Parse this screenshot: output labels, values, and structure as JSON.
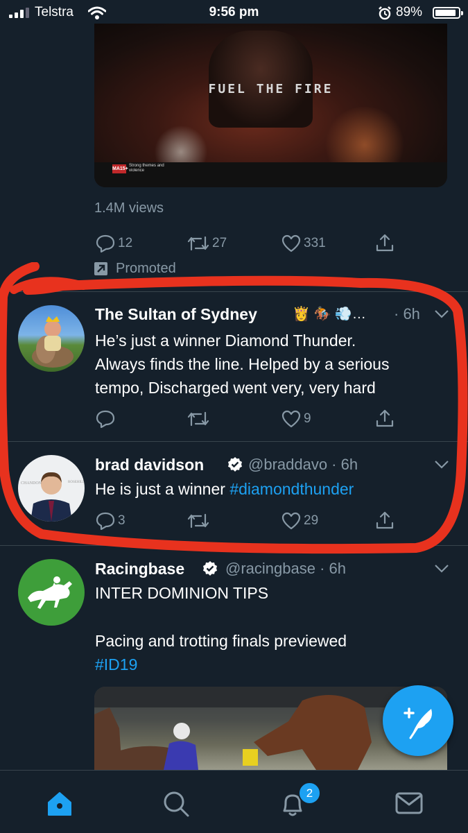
{
  "status_bar": {
    "carrier": "Telstra",
    "time": "9:56 pm",
    "battery": "89%"
  },
  "promo": {
    "video_title": "FUEL THE FIRE",
    "rating_label": "MA15+",
    "rating_text": "Strong themes and violence",
    "views": "1.4M views",
    "replies": "12",
    "retweets": "27",
    "likes": "331",
    "promoted_label": "Promoted"
  },
  "tweets": [
    {
      "name": "The Sultan of Sydney",
      "name_emoji": "👸 🏇 💨…",
      "time": "· 6h",
      "lines": [
        "He’s just a winner Diamond Thunder.",
        "Always finds the line. Helped by a serious",
        "tempo, Discharged went very, very hard"
      ],
      "replies": "",
      "retweets": "",
      "likes": "9"
    },
    {
      "name": "brad davidson",
      "handle": "@braddavo · 6h",
      "text": "He is just a winner ",
      "hashtag": "#diamondthunder",
      "replies": "3",
      "retweets": "",
      "likes": "29"
    },
    {
      "name": "Racingbase",
      "handle": "@racingbase · 6h",
      "line1": "INTER DOMINION TIPS",
      "line2": "Pacing and trotting finals previewed",
      "hashtag": "#ID19"
    }
  ],
  "tabbar": {
    "notifications_badge": "2"
  },
  "colors": {
    "background": "#15202b",
    "accent": "#1da1f2",
    "muted": "#8899a6",
    "highlight": "#e8321e"
  }
}
